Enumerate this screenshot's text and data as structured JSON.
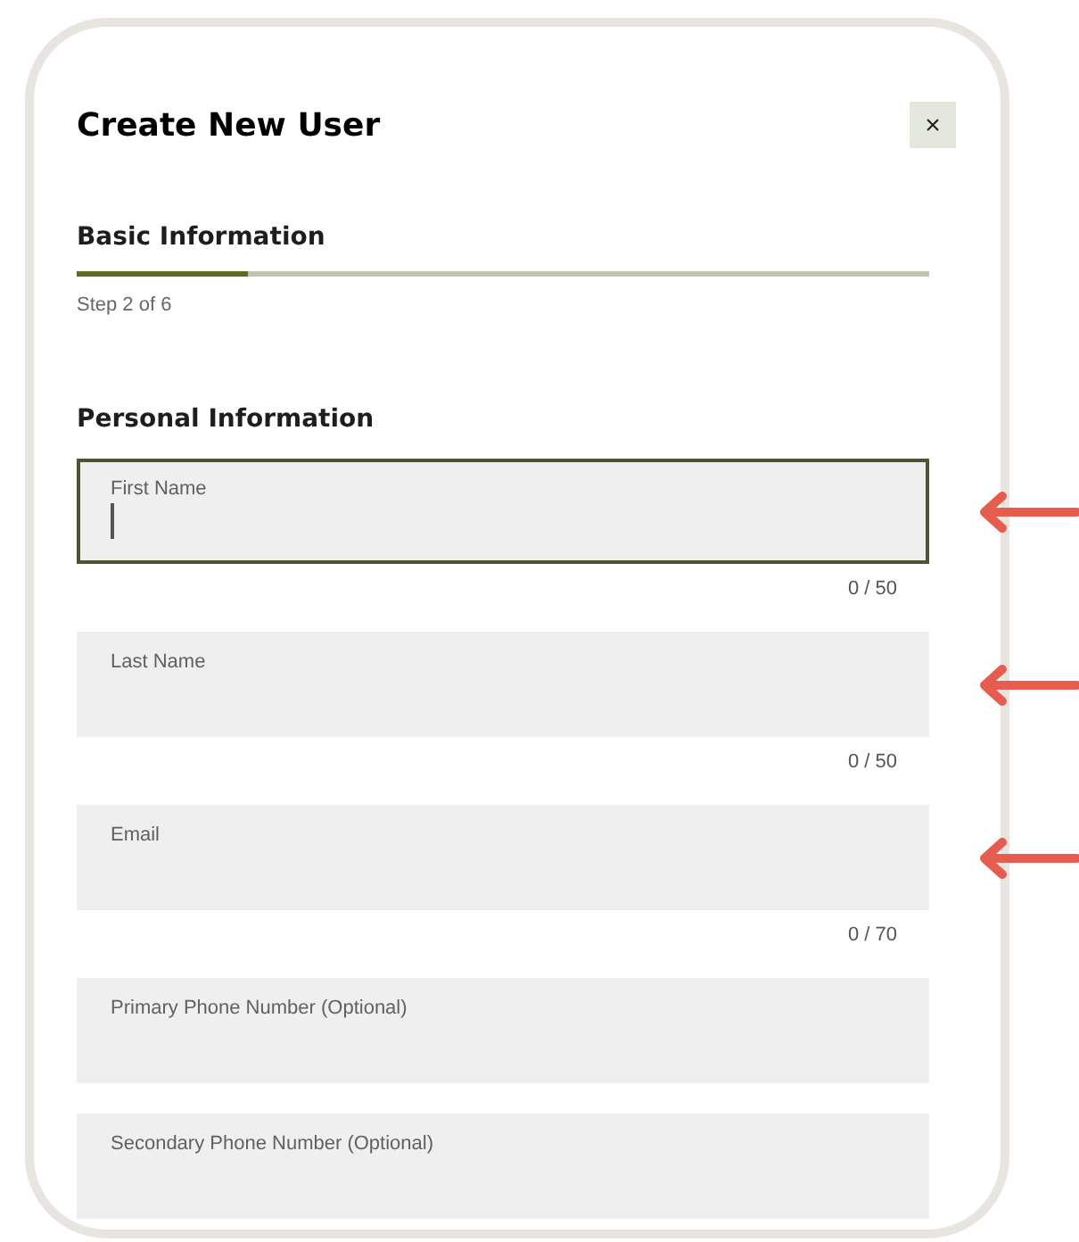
{
  "dialog": {
    "title": "Create New User",
    "close": "×"
  },
  "progress": {
    "heading": "Basic Information",
    "level": 0.2,
    "step": "Step 2 of 6"
  },
  "section": {
    "title": "Personal Information"
  },
  "fields": [
    {
      "label": "First Name",
      "focused": true,
      "counter": "0 / 50",
      "marked": true
    },
    {
      "label": "Last Name",
      "focused": false,
      "counter": "0 / 50",
      "marked": true
    },
    {
      "label": "Email",
      "focused": false,
      "counter": "0 / 70",
      "marked": true
    },
    {
      "label": "Primary Phone Number (Optional)",
      "focused": false,
      "marked": false
    },
    {
      "label": "Secondary Phone Number (Optional)",
      "focused": false,
      "marked": false
    }
  ]
}
